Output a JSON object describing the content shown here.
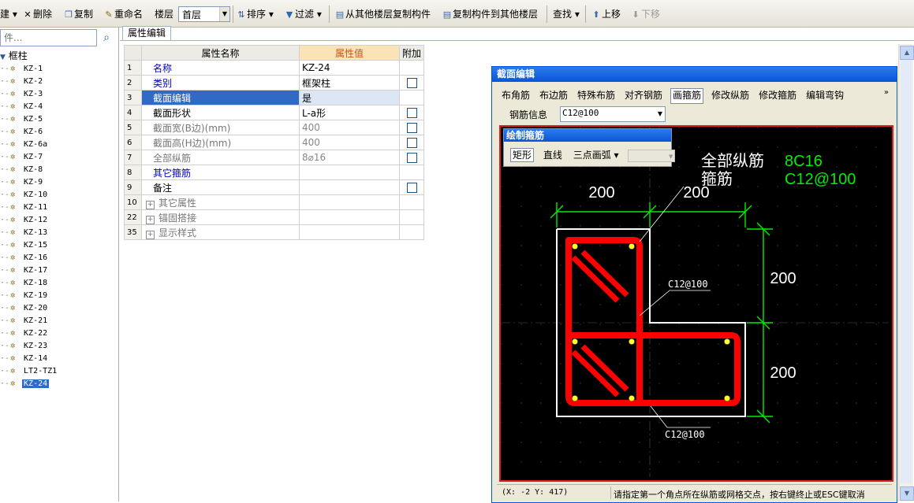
{
  "toolbar": {
    "new": "建",
    "delete": "删除",
    "copy": "复制",
    "rename": "重命名",
    "floor_label": "楼层",
    "floor_value": "首层",
    "sort": "排序",
    "filter": "过滤",
    "copy_from_floor": "从其他楼层复制构件",
    "copy_to_floor": "复制构件到其他楼层",
    "find": "查找",
    "move_up": "上移",
    "move_down": "下移"
  },
  "left": {
    "search_placeholder": "件...",
    "root": "框柱",
    "items": [
      "KZ-1",
      "KZ-2",
      "KZ-3",
      "KZ-4",
      "KZ-5",
      "KZ-6",
      "KZ-6a",
      "KZ-7",
      "KZ-8",
      "KZ-9",
      "KZ-10",
      "KZ-11",
      "KZ-12",
      "KZ-13",
      "KZ-15",
      "KZ-16",
      "KZ-17",
      "KZ-18",
      "KZ-19",
      "KZ-20",
      "KZ-21",
      "KZ-22",
      "KZ-23",
      "KZ-14",
      "LT2-TZ1",
      "KZ-24"
    ],
    "selected": "KZ-24"
  },
  "tab": "属性编辑",
  "grid": {
    "headers": {
      "name": "属性名称",
      "value": "属性值",
      "extra": "附加"
    },
    "rows": [
      {
        "num": "1",
        "name": "名称",
        "value": "KZ-24"
      },
      {
        "num": "2",
        "name": "类别",
        "value": "框架柱"
      },
      {
        "num": "3",
        "name": "截面编辑",
        "value": "是"
      },
      {
        "num": "4",
        "name": "截面形状",
        "value": "L-a形"
      },
      {
        "num": "5",
        "name": "截面宽(B边)(mm)",
        "value": "400"
      },
      {
        "num": "6",
        "name": "截面高(H边)(mm)",
        "value": "400"
      },
      {
        "num": "7",
        "name": "全部纵筋",
        "value": "8⌀16"
      },
      {
        "num": "8",
        "name": "其它箍筋",
        "value": ""
      },
      {
        "num": "9",
        "name": "备注",
        "value": ""
      },
      {
        "num": "10",
        "name": "其它属性",
        "value": ""
      },
      {
        "num": "22",
        "name": "锚固搭接",
        "value": ""
      },
      {
        "num": "35",
        "name": "显示样式",
        "value": ""
      }
    ]
  },
  "dialog": {
    "title": "截面编辑",
    "menu": [
      "布角筋",
      "布边筋",
      "特殊布筋",
      "对齐钢筋",
      "画箍筋",
      "修改纵筋",
      "修改箍筋",
      "编辑弯钩"
    ],
    "more": "»",
    "rebar_label": "钢筋信息",
    "rebar_value": "C12@100",
    "status_coord": "(X: -2 Y: 417)",
    "status_hint": "请指定第一个角点所在纵筋或网格交点，按右键终止或ESC键取消"
  },
  "subwin": {
    "title": "绘制箍筋",
    "tools": [
      "矩形",
      "直线",
      "三点画弧"
    ]
  },
  "drawing": {
    "label_all_long": "全部纵筋",
    "val_all_long": "8C16",
    "label_stirrup": "箍筋",
    "val_stirrup": "C12@100",
    "dim_top_left": "200",
    "dim_top_right": "200",
    "dim_right_top": "200",
    "dim_right_bottom": "200",
    "leader_mid": "C12@100",
    "leader_bottom": "C12@100"
  },
  "colors": {
    "dialog_title": "#0a55d8",
    "selected": "#316ac5",
    "dimension": "#00ee00",
    "rebar": "#ff0000"
  }
}
